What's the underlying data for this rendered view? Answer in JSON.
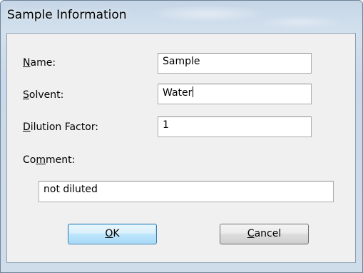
{
  "window": {
    "title": "Sample Information"
  },
  "form": {
    "name_label_mnemonic": "N",
    "name_label_rest": "ame:",
    "name_value": "Sample",
    "solvent_label_mnemonic": "S",
    "solvent_label_rest": "olvent:",
    "solvent_value": "Water",
    "dilution_label_mnemonic": "D",
    "dilution_label_rest": "ilution Factor:",
    "dilution_value": "1",
    "comment_label_pre": "Co",
    "comment_label_mnemonic": "m",
    "comment_label_rest": "ment:",
    "comment_value": "not diluted"
  },
  "buttons": {
    "ok_mnemonic": "O",
    "ok_rest": "K",
    "cancel_mnemonic": "C",
    "cancel_rest": "ancel"
  },
  "colors": {
    "title_bar": "#c9d9e9",
    "client_bg": "#f0f0f0",
    "default_button_border": "#3c7fb1"
  }
}
